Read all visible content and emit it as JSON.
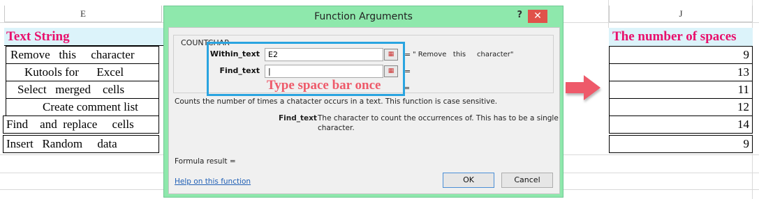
{
  "sheet": {
    "col_e_header": "E",
    "col_j_header": "J",
    "left_header": "Text String",
    "left_rows": [
      "Remove   this     character",
      "Kutools for      Excel",
      "Select   merged    cells",
      "Create comment list",
      "Find    and  replace     cells",
      "Insert   Random     data"
    ],
    "right_header": "The number of spaces",
    "right_values": [
      "9",
      "13",
      "11",
      "12",
      "14",
      "9"
    ]
  },
  "dialog": {
    "title": "Function Arguments",
    "help_glyph": "?",
    "close_glyph": "✕",
    "function_name": "COUNTCHAR",
    "args": [
      {
        "label": "Within_text",
        "value": "E2",
        "result": "\" Remove   this     character\""
      },
      {
        "label": "Find_text",
        "value": "|",
        "result": ""
      }
    ],
    "annotation": "Type space bar once",
    "description": "Counts the number of times a chatacter occurs in a text. This function is case sensitive.",
    "param_label": "Find_text",
    "param_desc_line1": "The character to count the occurrences of. This has to be a single",
    "param_desc_line2": "character.",
    "formula_result": "Formula result =",
    "help_link": "Help on this function",
    "ok_label": "OK",
    "cancel_label": "Cancel"
  },
  "colors": {
    "dialog_bg": "#8ee8ac",
    "header_fill": "#dcf3fa",
    "header_text": "#e8106c",
    "annotation": "#ee5a6a",
    "highlight": "#2aa4e0",
    "arrow": "#ee5a6a"
  },
  "icons": {
    "ref_button": "range-select-icon",
    "arrow": "right-arrow-icon"
  }
}
